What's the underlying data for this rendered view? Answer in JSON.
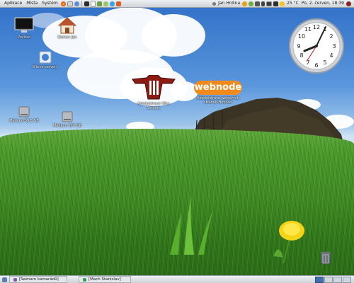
{
  "top_panel": {
    "menus": [
      "Aplikace",
      "Místa",
      "Systém"
    ],
    "user": "Jan Hrdina",
    "weather": "25 °C",
    "datetime": "Po, 2. červen, 18:39"
  },
  "desktop_icons": [
    {
      "label": "Počítač",
      "icon": "computer-icon"
    },
    {
      "label": "Domov Jan",
      "icon": "home-folder-icon"
    },
    {
      "label": "Síťové servery",
      "icon": "network-icon"
    },
    {
      "label": "Médium 89,5 GB",
      "icon": "drive-icon"
    },
    {
      "label": "Médium 160 GB",
      "icon": "drive-icon"
    },
    {
      "label": "Administrace Wiry Serveru",
      "icon": "wolfenstein-logo-icon"
    },
    {
      "label": "Administrace webových stránek Hrdinův",
      "icon": "webnode-logo-icon"
    }
  ],
  "logos": {
    "webnode": "webnode"
  },
  "bottom_panel": {
    "tasks": [
      {
        "label": "[Seznam kamarádů]"
      },
      {
        "label": "[Mach Stanislav]"
      }
    ]
  },
  "colors": {
    "panel_bg": "#dfe2e6",
    "sky": "#3a7bd0",
    "grass": "#3f8a22",
    "webnode_orange": "#f08a1c"
  }
}
